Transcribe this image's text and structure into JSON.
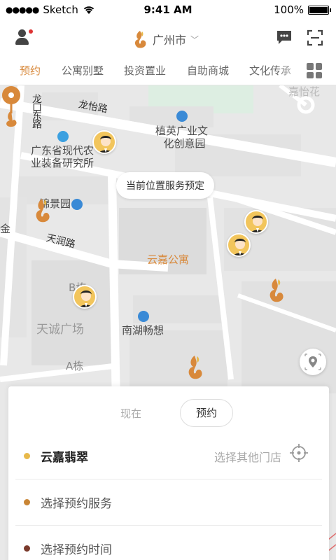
{
  "status_bar": {
    "carrier": "Sketch",
    "time": "9:41 AM",
    "battery": "100%"
  },
  "nav": {
    "city": "广州市"
  },
  "tabs": [
    {
      "label": "预约",
      "active": true
    },
    {
      "label": "公寓别墅"
    },
    {
      "label": "投资置业"
    },
    {
      "label": "自助商城"
    },
    {
      "label": "文化传承"
    }
  ],
  "map": {
    "tooltip": "当前位置服务预定",
    "pin_label": "云嘉公寓",
    "labels": {
      "longyi_road": "龙怡路",
      "longkou_east_road": "龙口东路",
      "zhiying_park": [
        "植英广业文",
        "化创意园"
      ],
      "gd_research": [
        "广东省现代农",
        "业装备研究所"
      ],
      "tianrun_road": "天润路",
      "nanhu": "南湖畅想",
      "tiancheng": "天诚广场",
      "jiayi": "嘉怡花",
      "building_b": "B栋",
      "building_a": "A栋",
      "jinjing": "锦景园",
      "jin": "金"
    }
  },
  "panel": {
    "mode_now": "现在",
    "mode_booking": "预约",
    "store_name": "云嘉翡翠",
    "store_switch": "选择其他门店",
    "service_placeholder": "选择预约服务",
    "time_placeholder": "选择预约时间"
  },
  "colors": {
    "accent": "#d8893b",
    "bullet1": "#e8b94a",
    "bullet2": "#c98535",
    "bullet3": "#7a3a2c"
  }
}
